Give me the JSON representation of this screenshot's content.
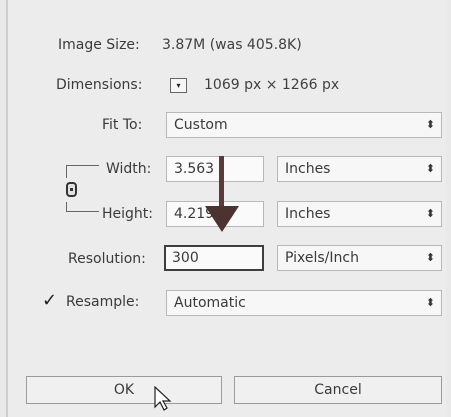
{
  "dialog": {
    "image_size_label": "Image Size:",
    "image_size_value": "3.87M (was 405.8K)",
    "gear_icon": "⚙",
    "dimensions_label": "Dimensions:",
    "dimensions_value": "1069 px  ×  1266 px",
    "fit_to_label": "Fit To:",
    "fit_to_value": "Custom",
    "width_label": "Width:",
    "width_value": "3.563",
    "width_unit": "Inches",
    "height_label": "Height:",
    "height_value": "4.219",
    "height_unit": "Inches",
    "resolution_label": "Resolution:",
    "resolution_value": "300",
    "resolution_unit": "Pixels/Inch",
    "resample_label": "Resample:",
    "resample_checked": true,
    "resample_value": "Automatic",
    "ok_label": "OK",
    "cancel_label": "Cancel"
  },
  "icons": {
    "chevron": "⬍",
    "check": "✓",
    "dimensions_dropdown": "▾"
  },
  "colors": {
    "annotation_arrow": "#5a3a3a",
    "dialog_bg": "#ececec"
  }
}
